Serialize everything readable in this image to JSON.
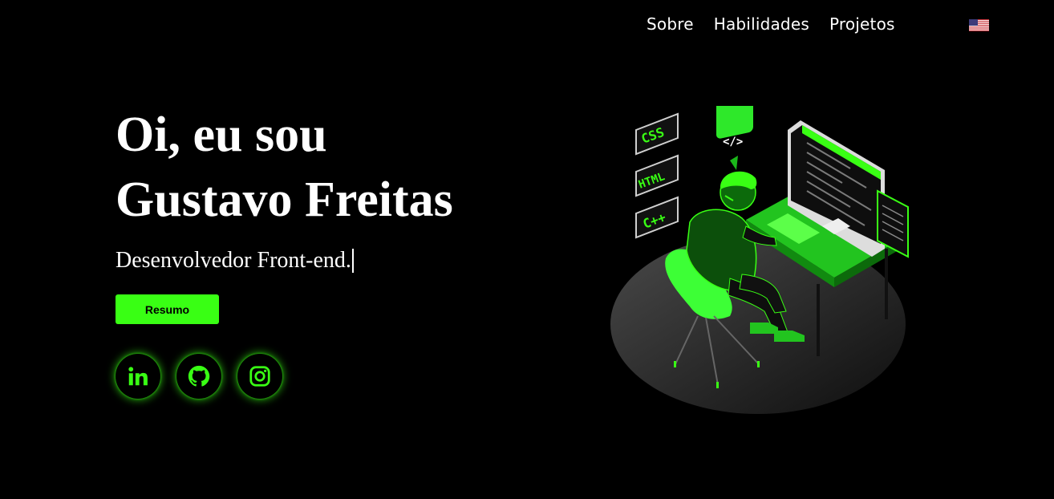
{
  "nav": {
    "items": [
      {
        "label": "Sobre"
      },
      {
        "label": "Habilidades"
      },
      {
        "label": "Projetos"
      }
    ],
    "language_icon": "us-flag-icon"
  },
  "hero": {
    "title_line1": "Oi, eu sou",
    "title_line2": "Gustavo Freitas",
    "subtitle": "Desenvolvedor Front-end.",
    "resume_button": "Resumo"
  },
  "socials": [
    {
      "icon": "linkedin-icon"
    },
    {
      "icon": "github-icon"
    },
    {
      "icon": "instagram-icon"
    }
  ],
  "illustration": {
    "tags": [
      "CSS",
      "HTML",
      "C++"
    ],
    "code_badge": "</>"
  },
  "colors": {
    "background": "#000000",
    "accent": "#39ff14",
    "text": "#ffffff"
  }
}
